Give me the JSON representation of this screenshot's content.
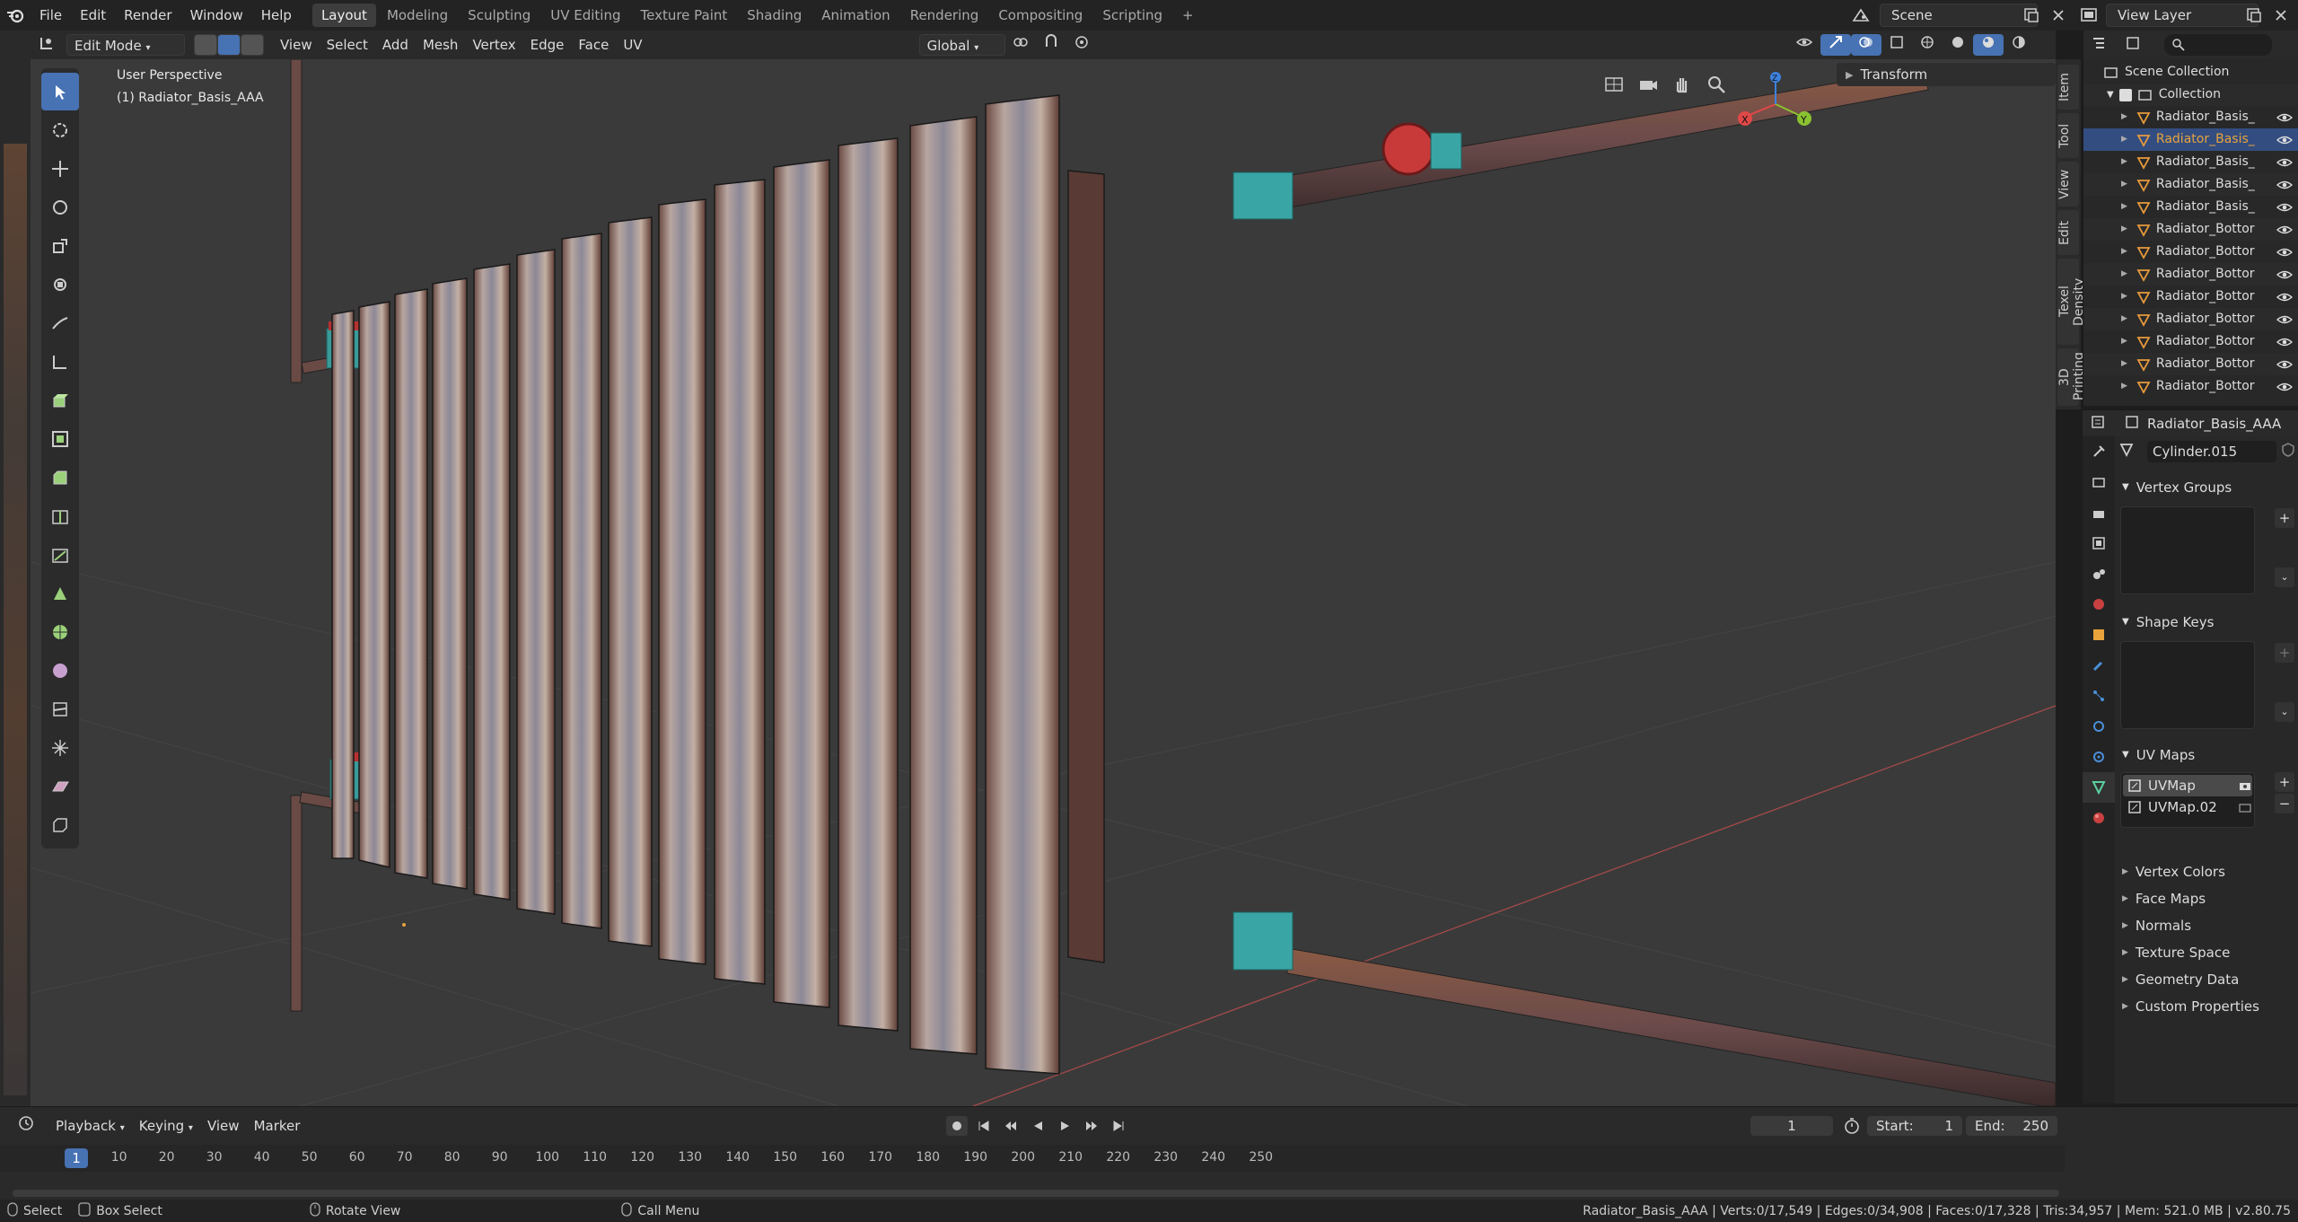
{
  "topbar": {
    "menus": [
      "File",
      "Edit",
      "Render",
      "Window",
      "Help"
    ],
    "workspaces": [
      "Layout",
      "Modeling",
      "Sculpting",
      "UV Editing",
      "Texture Paint",
      "Shading",
      "Animation",
      "Rendering",
      "Compositing",
      "Scripting"
    ],
    "active_workspace": "Layout",
    "add_tab": "+",
    "scene": "Scene",
    "view_layer": "View Layer"
  },
  "viewport_header": {
    "mode": "Edit Mode",
    "menus": [
      "View",
      "Select",
      "Add",
      "Mesh",
      "Vertex",
      "Edge",
      "Face",
      "UV"
    ],
    "orientation": "Global"
  },
  "viewport": {
    "perspective_label": "User Perspective",
    "object_label": "(1) Radiator_Basis_AAA",
    "transform_panel": "Transform",
    "gizmo_axes": {
      "x": "X",
      "y": "Y",
      "z": "Z"
    },
    "side_tabs": [
      "Item",
      "Tool",
      "View",
      "Edit",
      "Texel Density",
      "3D Printing"
    ]
  },
  "outliner": {
    "root": "Scene Collection",
    "collection": "Collection",
    "items": [
      {
        "name": "Radiator_Basis_",
        "highlight": false
      },
      {
        "name": "Radiator_Basis_",
        "highlight": true
      },
      {
        "name": "Radiator_Basis_",
        "highlight": false
      },
      {
        "name": "Radiator_Basis_",
        "highlight": false
      },
      {
        "name": "Radiator_Basis_",
        "highlight": false
      },
      {
        "name": "Radiator_Bottor",
        "highlight": false
      },
      {
        "name": "Radiator_Bottor",
        "highlight": false
      },
      {
        "name": "Radiator_Bottor",
        "highlight": false
      },
      {
        "name": "Radiator_Bottor",
        "highlight": false
      },
      {
        "name": "Radiator_Bottor",
        "highlight": false
      },
      {
        "name": "Radiator_Bottor",
        "highlight": false
      },
      {
        "name": "Radiator_Bottor",
        "highlight": false
      },
      {
        "name": "Radiator_Bottor",
        "highlight": false
      }
    ]
  },
  "properties": {
    "object_name": "Radiator_Basis_AAA",
    "mesh_name": "Cylinder.015",
    "sections": {
      "vertex_groups": "Vertex Groups",
      "shape_keys": "Shape Keys",
      "uv_maps": "UV Maps",
      "collapsed": [
        "Vertex Colors",
        "Face Maps",
        "Normals",
        "Texture Space",
        "Geometry Data",
        "Custom Properties"
      ]
    },
    "uv_maps": [
      "UVMap",
      "UVMap.02"
    ]
  },
  "timeline": {
    "menus": [
      "Playback",
      "Keying",
      "View",
      "Marker"
    ],
    "current_frame": "1",
    "start_label": "Start:",
    "start": "1",
    "end_label": "End:",
    "end": "250",
    "ticks": [
      "1",
      "10",
      "20",
      "30",
      "40",
      "50",
      "60",
      "70",
      "80",
      "90",
      "100",
      "110",
      "120",
      "130",
      "140",
      "150",
      "160",
      "170",
      "180",
      "190",
      "200",
      "210",
      "220",
      "230",
      "240",
      "250"
    ]
  },
  "statusbar": {
    "select": "Select",
    "box_select": "Box Select",
    "rotate_view": "Rotate View",
    "call_menu": "Call Menu",
    "stats": "Radiator_Basis_AAA | Verts:0/17,549 | Edges:0/34,908 | Faces:0/17,328 | Tris:34,957 | Mem: 521.0 MB | v2.80.75"
  },
  "colors": {
    "accent": "#4772b3",
    "highlight_text": "#e8a33c",
    "mesh_icon": "#e89a3c",
    "axis_x": "#e04848",
    "axis_y": "#8ac231",
    "axis_z": "#3c82e0"
  }
}
